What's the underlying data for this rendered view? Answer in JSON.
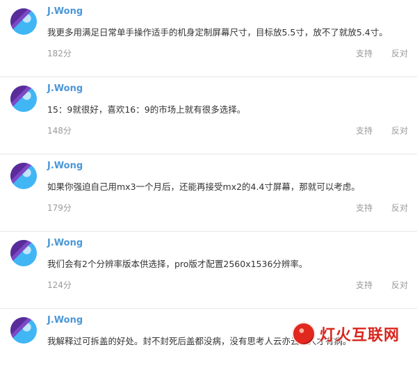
{
  "comments": [
    {
      "author": "J.Wong",
      "text": "我更多用满足日常单手操作适手的机身定制屏幕尺寸，目标放5.5寸，放不了就放5.4寸。",
      "score": "182分",
      "support": "支持",
      "oppose": "反对"
    },
    {
      "author": "J.Wong",
      "text": "15：9就很好，喜欢16：9的市场上就有很多选择。",
      "score": "148分",
      "support": "支持",
      "oppose": "反对"
    },
    {
      "author": "J.Wong",
      "text": "如果你强迫自己用mx3一个月后，还能再接受mx2的4.4寸屏幕，那就可以考虑。",
      "score": "179分",
      "support": "支持",
      "oppose": "反对"
    },
    {
      "author": "J.Wong",
      "text": "我们会有2个分辨率版本供选择，pro版才配置2560x1536分辨率。",
      "score": "124分",
      "support": "支持",
      "oppose": "反对"
    },
    {
      "author": "J.Wong",
      "text": "我解释过可拆盖的好处。封不封死后盖都没病，没有思考人云亦云的人才有病。",
      "score": "",
      "support": "",
      "oppose": ""
    }
  ],
  "watermark": {
    "text": "灯火互联网",
    "icon": "fire-logo-icon"
  },
  "colors": {
    "author": "#4a97d8",
    "muted": "#999999",
    "text": "#333333",
    "watermark": "#d9251c"
  }
}
